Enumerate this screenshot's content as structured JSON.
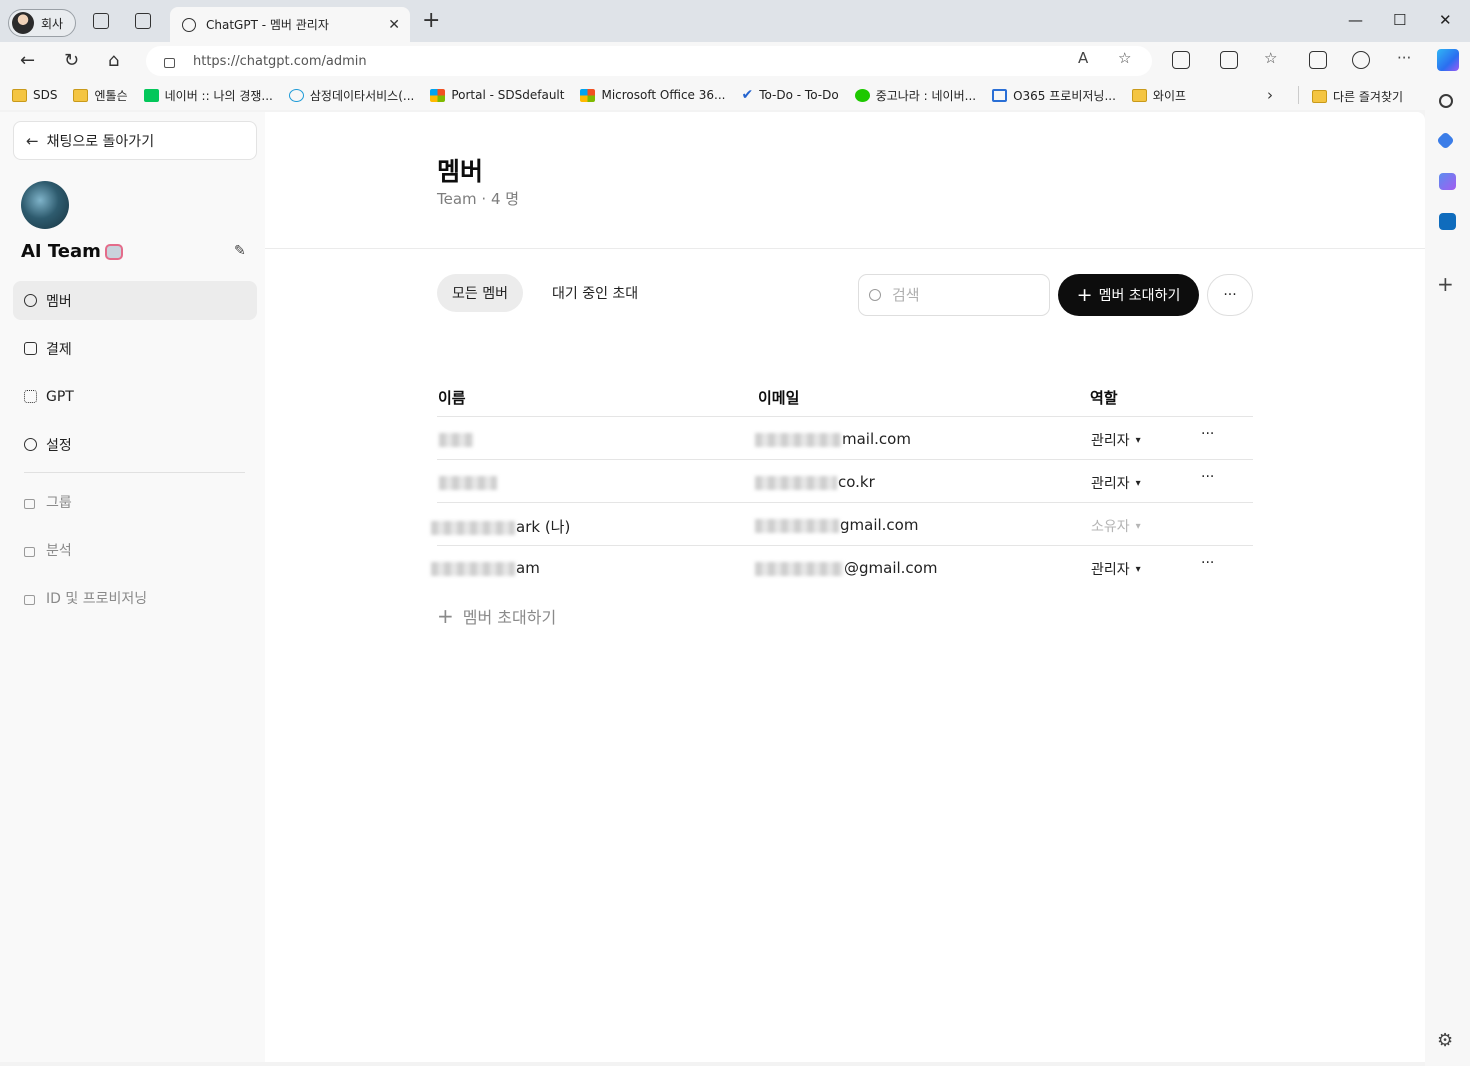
{
  "browser": {
    "profile_label": "회사",
    "tab_title": "ChatGPT - 멤버 관리자",
    "url": "https://chatgpt.com/admin",
    "bookmarks": [
      "SDS",
      "엔톨슨",
      "네이버 :: 나의 경쟁...",
      "삼정데이타서비스(...",
      "Portal - SDSdefault",
      "Microsoft Office 36...",
      "To-Do - To-Do",
      "중고나라 : 네이버...",
      "O365 프로비저닝...",
      "와이프"
    ],
    "other_favorites": "다른 즐겨찾기"
  },
  "sidebar": {
    "back_label": "채팅으로 돌아가기",
    "workspace_name": "AI Team",
    "items": [
      {
        "label": "멤버",
        "active": true,
        "locked": false
      },
      {
        "label": "결제",
        "active": false,
        "locked": false
      },
      {
        "label": "GPT",
        "active": false,
        "locked": false
      },
      {
        "label": "설정",
        "active": false,
        "locked": false
      },
      {
        "label": "그룹",
        "active": false,
        "locked": true
      },
      {
        "label": "분석",
        "active": false,
        "locked": true
      },
      {
        "label": "ID 및 프로비저닝",
        "active": false,
        "locked": true
      }
    ]
  },
  "main": {
    "title": "멤버",
    "subtitle": "Team · 4 명",
    "tabs": [
      "모든 멤버",
      "대기 중인 초대"
    ],
    "search_placeholder": "검색",
    "invite_label": "멤버 초대하기",
    "more_label": "···",
    "columns": [
      "이름",
      "이메일",
      "역할"
    ],
    "rows": [
      {
        "name_suffix": "",
        "email_suffix": "mail.com",
        "role": "관리자",
        "editable": true
      },
      {
        "name_suffix": "",
        "email_suffix": "co.kr",
        "role": "관리자",
        "editable": true
      },
      {
        "name_suffix": "ark (나)",
        "email_suffix": "gmail.com",
        "role": "소유자",
        "editable": false
      },
      {
        "name_suffix": "am",
        "email_suffix": "@gmail.com",
        "role": "관리자",
        "editable": true
      }
    ],
    "add_member_label": "멤버 초대하기"
  },
  "colors": {
    "accent": "#0d0d0d",
    "sidebar_bg": "#f9f9f9",
    "active_bg": "#ececec"
  }
}
